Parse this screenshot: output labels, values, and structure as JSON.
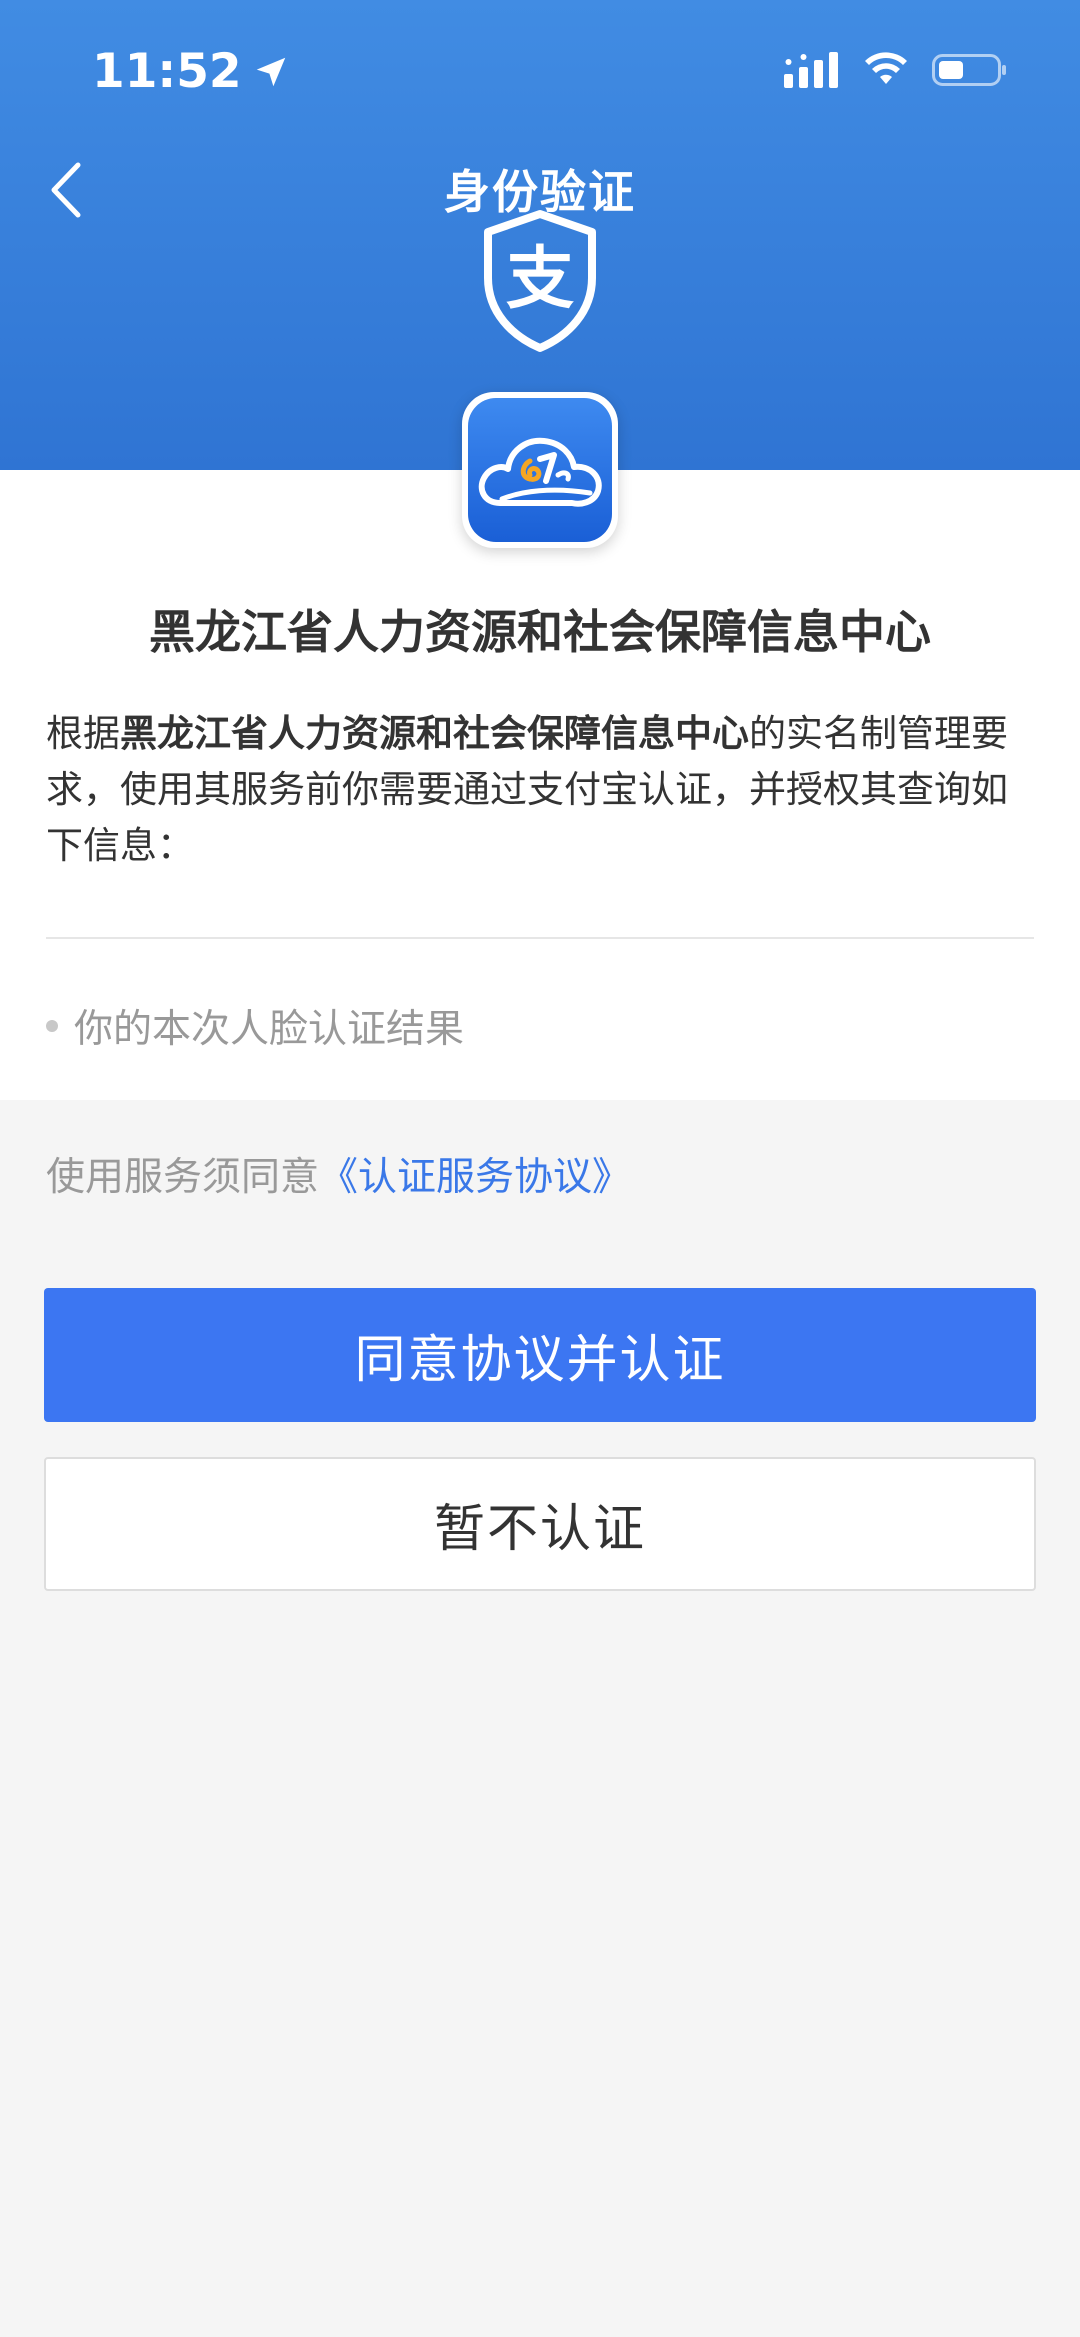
{
  "status_bar": {
    "time": "11:52",
    "icons": [
      "location-arrow-icon",
      "cellular-signal-icon",
      "wifi-icon",
      "battery-icon"
    ]
  },
  "nav": {
    "title": "身份验证",
    "back_icon": "chevron-left-icon",
    "brand_icon": "alipay-shield-icon",
    "brand_glyph": "支"
  },
  "app": {
    "logo_icon": "cloud-12333-logo-icon",
    "name": "黑龙江省人力资源和社会保障信息中心"
  },
  "description": {
    "prefix": "根据",
    "org": "黑龙江省人力资源和社会保障信息中心",
    "suffix": "的实名制管理要求，使用其服务前你需要通过支付宝认证，并授权其查询如下信息："
  },
  "info_items": [
    "你的本次人脸认证结果"
  ],
  "agreement": {
    "prefix": "使用服务须同意",
    "link": "《认证服务协议》"
  },
  "buttons": {
    "agree": "同意协议并认证",
    "decline": "暂不认证"
  },
  "colors": {
    "header_top": "#418ce3",
    "header_bottom": "#2f74d3",
    "primary_button": "#3c76f2",
    "link": "#3a78e8",
    "background": "#f5f5f5"
  }
}
